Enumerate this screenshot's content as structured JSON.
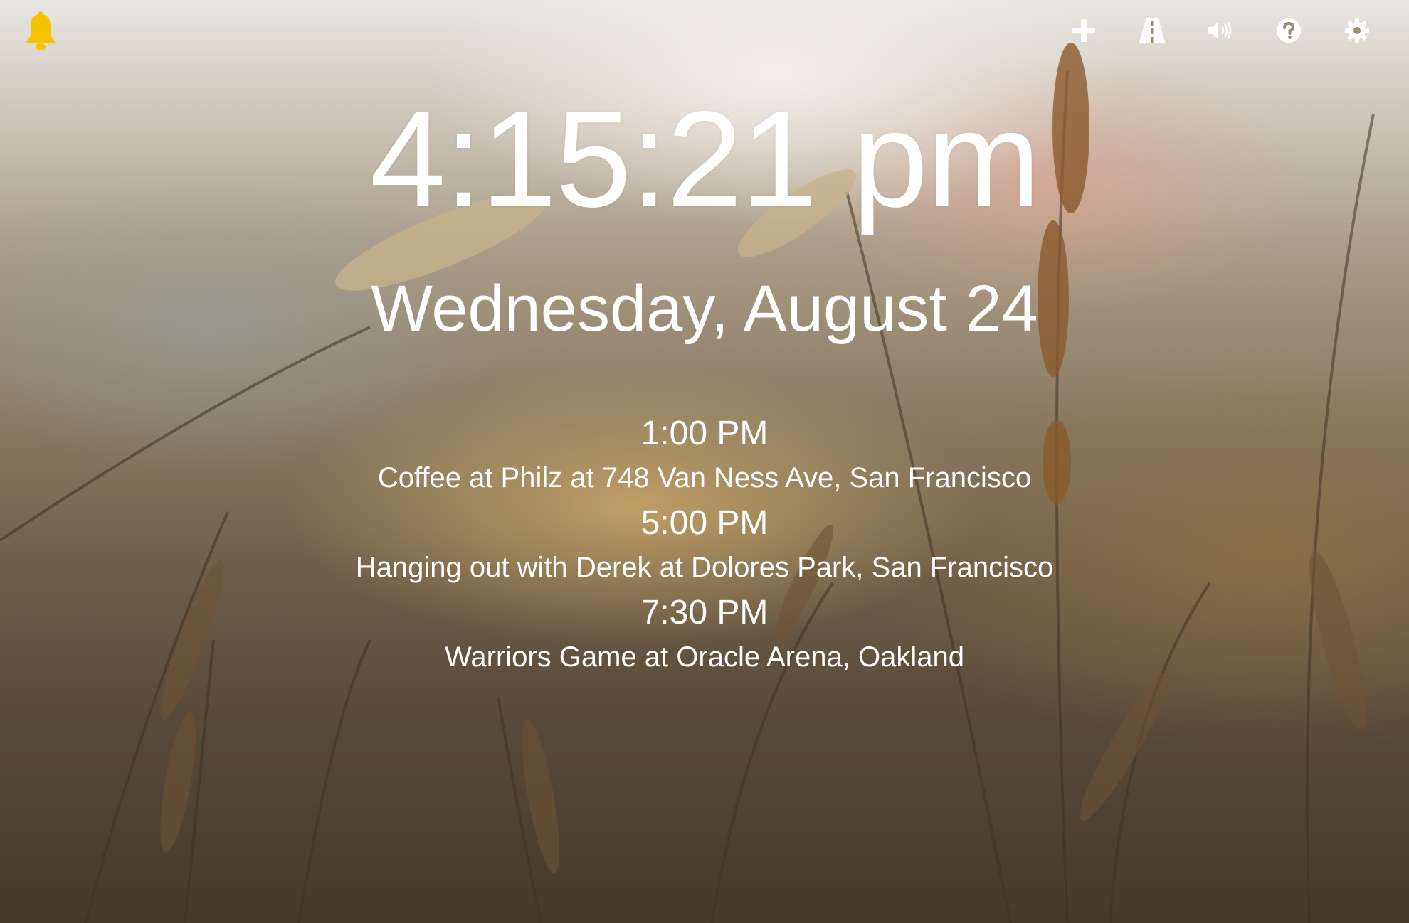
{
  "clock": {
    "time": "4:15:21 pm"
  },
  "date": {
    "text": "Wednesday, August 24"
  },
  "events": [
    {
      "time": "1:00 PM",
      "title": "Coffee at Philz at 748 Van Ness Ave, San Francisco"
    },
    {
      "time": "5:00 PM",
      "title": "Hanging out with Derek at Dolores Park, San Francisco"
    },
    {
      "time": "7:30 PM",
      "title": "Warriors Game at Oracle Arena, Oakland"
    }
  ],
  "toolbar": {
    "icons": [
      "plus-icon",
      "road-icon",
      "volume-icon",
      "help-icon",
      "gear-icon"
    ]
  },
  "alerts": {
    "icon": "bell-icon",
    "color": "#f5c400"
  },
  "colors": {
    "text": "#ffffff",
    "bell": "#f5c400"
  }
}
